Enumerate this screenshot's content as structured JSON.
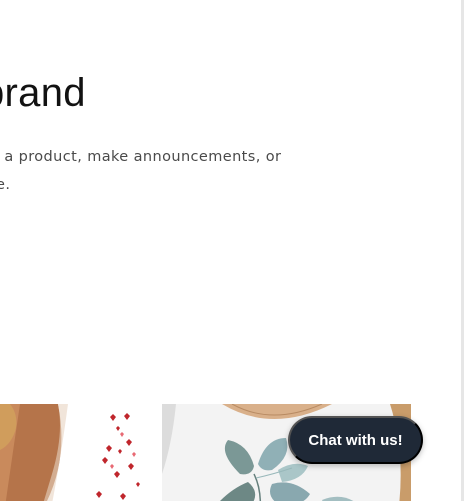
{
  "hero": {
    "heading": "brand",
    "text_lines": [
      "e a product, make announcements, or",
      "re."
    ]
  },
  "products": [
    {
      "image": "hearts-print-top-photo"
    },
    {
      "image": "leaf-print-top-photo"
    }
  ],
  "chat": {
    "label": "Chat with us!"
  },
  "colors": {
    "chat_bg": "#1f2937",
    "text": "#121212",
    "muted_text": "#4a4a4a"
  }
}
